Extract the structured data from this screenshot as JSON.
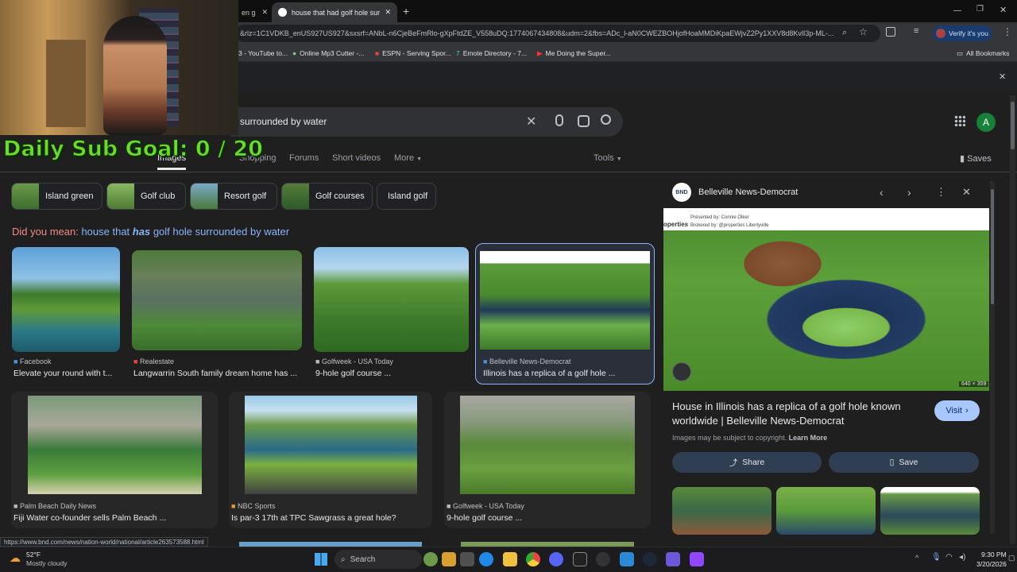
{
  "browser": {
    "tabs": [
      {
        "label": "en g"
      },
      {
        "label": "house that had golf hole surrou"
      }
    ],
    "new_tab": "+",
    "url": "&rlz=1C1VDKB_enUS927US927&sxsrf=ANbL-n6CjeBeFmRlo-gXpFtdZE_V558uDQ:1774067434808&udm=2&fbs=ADc_l-aN0CWEZBOHjofHoaMMDiKpaEWjvZ2Py1XXV8d8KvlI3p-ML-...",
    "verify_label": "Verify it's you",
    "bookmarks": [
      {
        "label": "3 - YouTube to..."
      },
      {
        "label": "Online Mp3 Cutter -..."
      },
      {
        "label": "ESPN - Serving Spor..."
      },
      {
        "label": "Emote Directory - 7..."
      },
      {
        "label": "Me Doing the Super..."
      }
    ],
    "all_bookmarks": "All Bookmarks"
  },
  "search": {
    "query": "surrounded by water",
    "account_initial": "A",
    "nav": [
      {
        "label": "Images"
      },
      {
        "label": "Shopping"
      },
      {
        "label": "Forums"
      },
      {
        "label": "Short videos"
      },
      {
        "label": "More"
      }
    ],
    "tools": "Tools",
    "saves": "Saves",
    "chips": [
      {
        "label": "Island green"
      },
      {
        "label": "Golf club"
      },
      {
        "label": "Resort golf"
      },
      {
        "label": "Golf courses"
      },
      {
        "label": "Island golf"
      }
    ],
    "did_you_mean": "Did you mean:",
    "suggestion_pre": "house that",
    "suggestion_em": "has",
    "suggestion_post": "golf hole surrounded by water"
  },
  "results_row1": [
    {
      "source": "Facebook",
      "caption": "Elevate your round with t..."
    },
    {
      "source": "Realestate",
      "caption": "Langwarrin South family dream home has ..."
    },
    {
      "source": "Golfweek - USA Today",
      "caption": "9-hole golf course ..."
    },
    {
      "source": "Belleville News-Democrat",
      "caption": "Illinois has a replica of a golf hole ..."
    }
  ],
  "results_row2": [
    {
      "source": "Palm Beach Daily News",
      "caption": "Fiji Water co-founder sells Palm Beach ..."
    },
    {
      "source": "NBC Sports",
      "caption": "Is par-3 17th at TPC Sawgrass a great hole?"
    },
    {
      "source": "Golfweek - USA Today",
      "caption": "9-hole golf course ..."
    }
  ],
  "panel": {
    "source": "Belleville News-Democrat",
    "presented_by": "Presented by: Connie Olker",
    "brokered_by": "Brokered by: @properties Libertyville",
    "brand": "operties",
    "dims": "640 × 359",
    "title": "House in Illinois has a replica of a golf hole known worldwide | Belleville News-Democrat",
    "visit": "Visit",
    "copyright": "Images may be subject to copyright.",
    "learn_more": "Learn More",
    "share": "Share",
    "save": "Save"
  },
  "status_url": "https://www.bnd.com/news/nation-world/national/article263573588.html",
  "taskbar": {
    "temp": "52°F",
    "weather": "Mostly cloudy",
    "search": "Search",
    "time": "9:30 PM",
    "date": "3/20/2026"
  },
  "overlay": {
    "goal": "Daily Sub Goal:  0 / 20"
  },
  "colors": {
    "did_you_mean": "#f28b82",
    "link": "#8ab4f8",
    "goal_text": "#6bdc2a",
    "panel_button": "#303e53"
  }
}
